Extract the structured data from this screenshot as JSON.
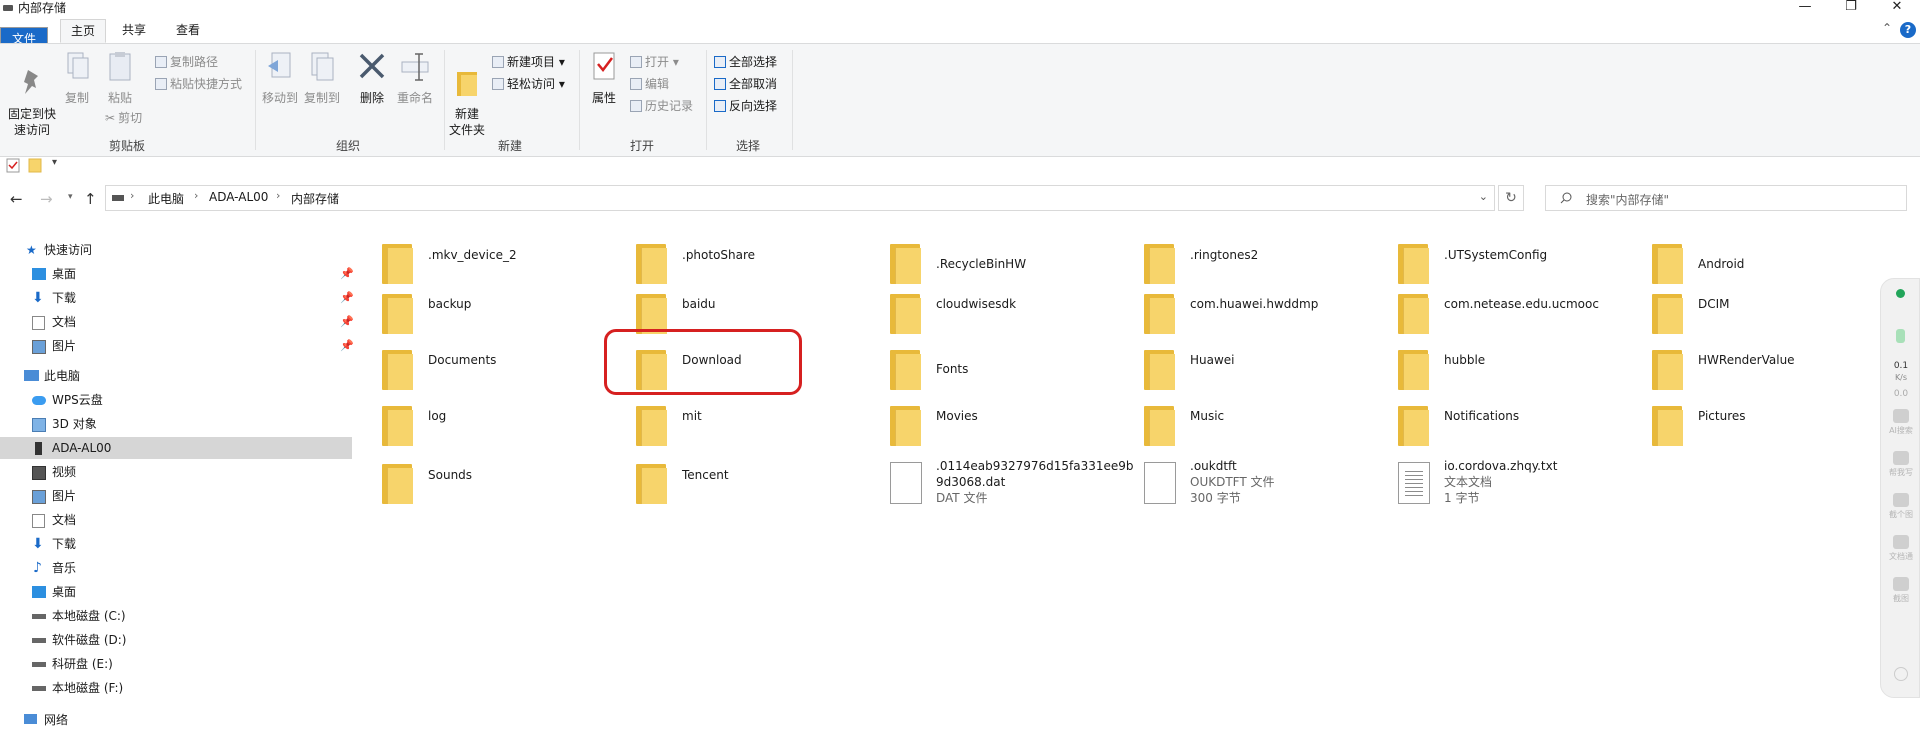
{
  "window": {
    "title": "内部存储",
    "controls": [
      "—",
      "❐",
      "✕"
    ]
  },
  "tabs": {
    "file": "文件",
    "home": "主页",
    "share": "共享",
    "view": "查看",
    "help": "?",
    "collapse": "⌃"
  },
  "ribbon": {
    "pin": "固定到快\n速访问",
    "copy": "复制",
    "paste": "粘贴",
    "copy_path": "复制路径",
    "paste_shortcut": "粘贴快捷方式",
    "cut": "剪切",
    "clipboard_group": "剪贴板",
    "move_to": "移动到",
    "copy_to": "复制到",
    "delete": "删除",
    "rename": "重命名",
    "organize_group": "组织",
    "new_folder": "新建\n文件夹",
    "new_item": "新建项目",
    "easy_access": "轻松访问",
    "new_group": "新建",
    "properties": "属性",
    "open": "打开",
    "edit": "编辑",
    "history": "历史记录",
    "open_group": "打开",
    "select_all": "全部选择",
    "select_none": "全部取消",
    "invert": "反向选择",
    "select_group": "选择"
  },
  "address": {
    "crumbs": [
      "此电脑",
      "ADA-AL00",
      "内部存储"
    ],
    "search_placeholder": "搜索\"内部存储\""
  },
  "sidebar": {
    "quick_access": "快速访问",
    "quick_items": [
      "桌面",
      "下载",
      "文档",
      "图片"
    ],
    "this_pc": "此电脑",
    "pc_items": [
      "WPS云盘",
      "3D 对象",
      "ADA-AL00",
      "视频",
      "图片",
      "文档",
      "下载",
      "音乐",
      "桌面",
      "本地磁盘 (C:)",
      "软件磁盘 (D:)",
      "科研盘 (E:)",
      "本地磁盘 (F:)"
    ],
    "network": "网络"
  },
  "items": [
    {
      "name": ".mkv_device_2",
      "kind": "folder"
    },
    {
      "name": ".photoShare",
      "kind": "folder"
    },
    {
      "name": ".RecycleBinHW",
      "kind": "folder"
    },
    {
      "name": ".ringtones2",
      "kind": "folder"
    },
    {
      "name": ".UTSystemConfig",
      "kind": "folder"
    },
    {
      "name": "Android",
      "kind": "folder"
    },
    {
      "name": "backup",
      "kind": "folder"
    },
    {
      "name": "baidu",
      "kind": "folder"
    },
    {
      "name": "cloudwisesdk",
      "kind": "folder"
    },
    {
      "name": "com.huawei.hwddmp",
      "kind": "folder"
    },
    {
      "name": "com.netease.edu.ucmooc",
      "kind": "folder"
    },
    {
      "name": "DCIM",
      "kind": "folder"
    },
    {
      "name": "Documents",
      "kind": "folder"
    },
    {
      "name": "Download",
      "kind": "folder"
    },
    {
      "name": "Fonts",
      "kind": "folder"
    },
    {
      "name": "Huawei",
      "kind": "folder"
    },
    {
      "name": "hubble",
      "kind": "folder"
    },
    {
      "name": "HWRenderValue",
      "kind": "folder"
    },
    {
      "name": "log",
      "kind": "folder"
    },
    {
      "name": "mit",
      "kind": "folder"
    },
    {
      "name": "Movies",
      "kind": "folder"
    },
    {
      "name": "Music",
      "kind": "folder"
    },
    {
      "name": "Notifications",
      "kind": "folder"
    },
    {
      "name": "Pictures",
      "kind": "folder"
    },
    {
      "name": "Sounds",
      "kind": "folder"
    },
    {
      "name": "Tencent",
      "kind": "folder"
    },
    {
      "name": ".0114eab9327976d15fa331ee9b",
      "name2": "9d3068.dat",
      "type": "DAT 文件",
      "kind": "file"
    },
    {
      "name": ".oukdtft",
      "type": "OUKDTFT 文件",
      "size": "300 字节",
      "kind": "file"
    },
    {
      "name": "io.cordova.zhqy.txt",
      "type": "文本文档",
      "size": "1 字节",
      "kind": "txt"
    }
  ],
  "float_panel": {
    "speed": "0.1",
    "speed_unit": "K/s",
    "speed2": "0.0",
    "tools": [
      "AI搜索",
      "帮我写",
      "截个图",
      "文档通",
      "截图"
    ]
  },
  "colors": {
    "accent": "#1a6ac8",
    "folder": "#f7d46b",
    "highlight": "#d62020"
  }
}
